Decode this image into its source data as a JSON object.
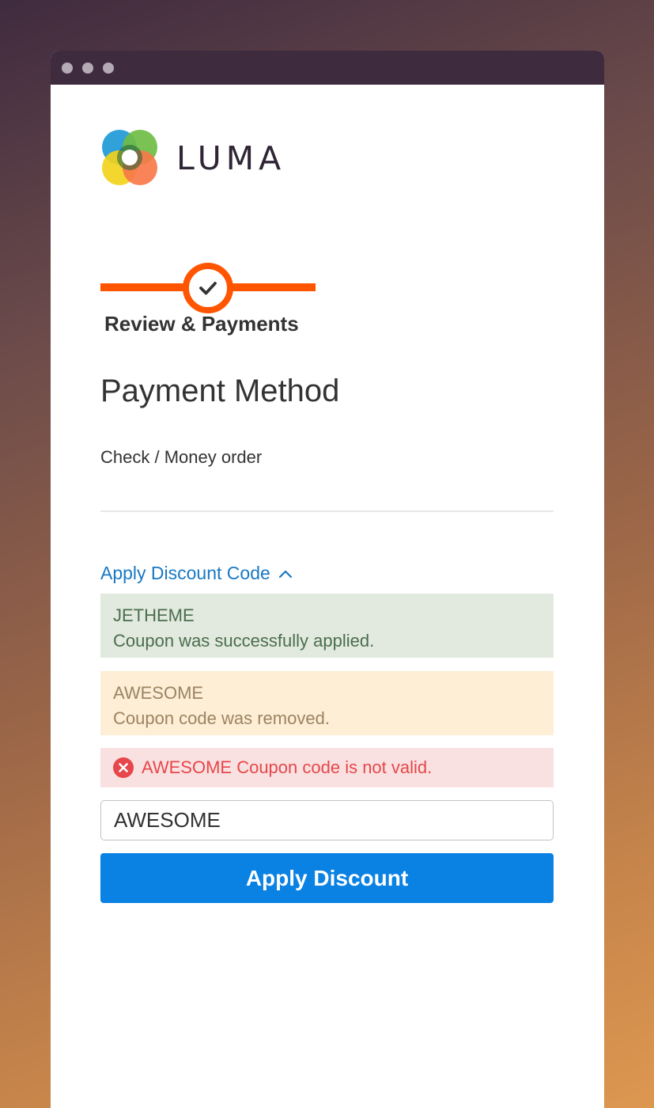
{
  "brand": {
    "name": "LUMA",
    "logo_colors": [
      "#1e9ad6",
      "#6fbd44",
      "#f7941d",
      "#f2d21c",
      "#ee3e4a"
    ]
  },
  "progress": {
    "step_label": "Review & Payments",
    "accent_color": "#ff5501",
    "icon": "checkmark-icon"
  },
  "payment": {
    "title": "Payment Method",
    "selected_option": "Check / Money order"
  },
  "discount": {
    "toggle_label": "Apply Discount Code",
    "toggle_icon": "chevron-up-icon",
    "messages": {
      "success": {
        "code": "JETHEME",
        "text": "Coupon was successfully applied."
      },
      "warning": {
        "code": "AWESOME",
        "text": "Coupon code was removed."
      },
      "error": {
        "icon": "error-circle-icon",
        "text": "AWESOME Coupon code is not valid."
      }
    },
    "input_value": "AWESOME",
    "button_label": "Apply Discount",
    "button_color": "#0a82e4"
  }
}
